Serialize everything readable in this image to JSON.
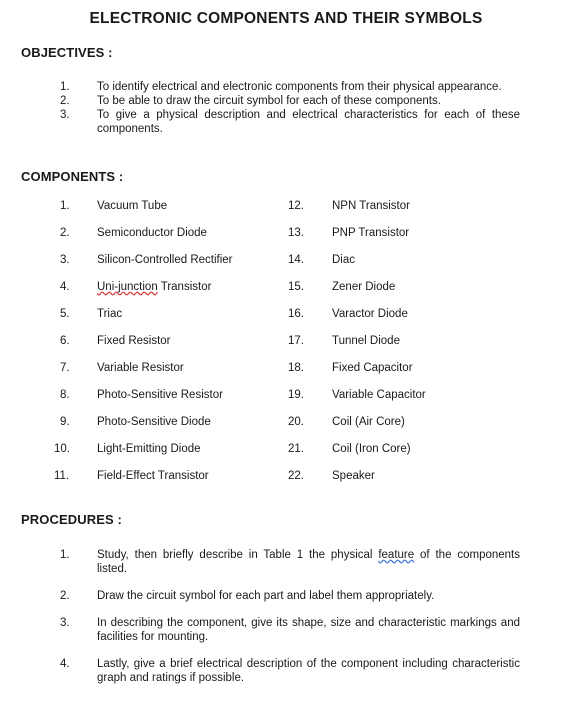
{
  "document": {
    "title": "ELECTRONIC COMPONENTS AND THEIR SYMBOLS"
  },
  "objectives": {
    "heading": "OBJECTIVES :",
    "items": [
      {
        "num": "1.",
        "text": "To identify electrical and electronic components from their physical appearance."
      },
      {
        "num": "2.",
        "text": "To be able to draw the circuit symbol for each of these components."
      },
      {
        "num": "3.",
        "text": "To give a physical description and electrical characteristics for each of these components."
      }
    ]
  },
  "components": {
    "heading": "COMPONENTS :",
    "left_column": [
      {
        "num": "1.",
        "label": "Vacuum Tube"
      },
      {
        "num": "2.",
        "label": "Semiconductor Diode"
      },
      {
        "num": "3.",
        "label": "Silicon-Controlled Rectifier"
      },
      {
        "num": "4.",
        "label": "Uni-junction Transistor",
        "spell_error_part": "Uni-junction",
        "rest": " Transistor"
      },
      {
        "num": "5.",
        "label": "Triac"
      },
      {
        "num": "6.",
        "label": "Fixed Resistor"
      },
      {
        "num": "7.",
        "label": "Variable Resistor"
      },
      {
        "num": "8.",
        "label": "Photo-Sensitive Resistor"
      },
      {
        "num": "9.",
        "label": "Photo-Sensitive Diode"
      },
      {
        "num": "10.",
        "label": "Light-Emitting Diode"
      },
      {
        "num": "11.",
        "label": "Field-Effect Transistor"
      }
    ],
    "right_column": [
      {
        "num": "12.",
        "label": "NPN Transistor"
      },
      {
        "num": "13.",
        "label": "PNP Transistor"
      },
      {
        "num": "14.",
        "label": "Diac"
      },
      {
        "num": "15.",
        "label": "Zener Diode"
      },
      {
        "num": "16.",
        "label": "Varactor Diode"
      },
      {
        "num": "17.",
        "label": "Tunnel Diode"
      },
      {
        "num": "18.",
        "label": "Fixed Capacitor"
      },
      {
        "num": "19.",
        "label": "Variable Capacitor"
      },
      {
        "num": "20.",
        "label": "Coil (Air Core)"
      },
      {
        "num": "21.",
        "label": "Coil (Iron Core)"
      },
      {
        "num": "22.",
        "label": "Speaker"
      }
    ]
  },
  "procedures": {
    "heading": "PROCEDURES :",
    "items": [
      {
        "num": "1.",
        "text_before": "Study, then briefly describe in Table 1 the physical ",
        "grammar_error_part": "feature",
        "text_after": " of the components listed."
      },
      {
        "num": "2.",
        "text": "Draw the circuit symbol for each part and label them appropriately."
      },
      {
        "num": "3.",
        "text": "In describing the component, give its shape, size and characteristic markings and facilities for mounting."
      },
      {
        "num": "4.",
        "text": "Lastly, give a brief electrical description of the component including characteristic graph and ratings if possible."
      }
    ]
  },
  "colors": {
    "text": "#1a1a1a",
    "background": "#ffffff",
    "spell_error_underline": "#e03030",
    "grammar_error_underline": "#3b6fd4"
  }
}
